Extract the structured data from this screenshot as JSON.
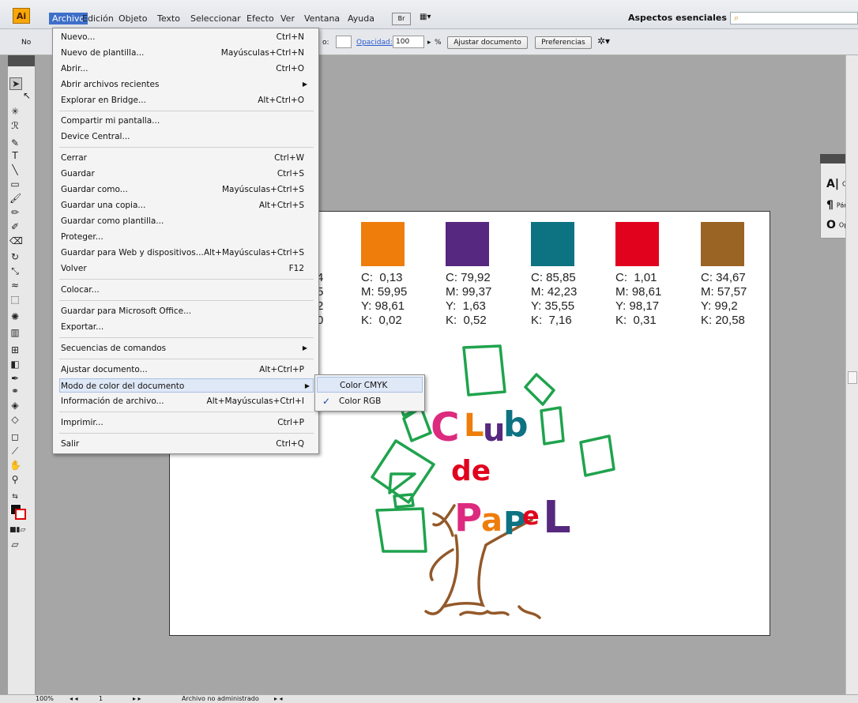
{
  "app": {
    "logo": "Ai"
  },
  "menubar": {
    "items": [
      "Archivo",
      "Edición",
      "Objeto",
      "Texto",
      "Seleccionar",
      "Efecto",
      "Ver",
      "Ventana",
      "Ayuda"
    ],
    "bridge_label": "Br",
    "workspace": "Aspectos esenciales ▾"
  },
  "controlbar": {
    "left_label": "No",
    "style_label": "o:",
    "opacity_label": "Opacidad:",
    "opacity_value": "100",
    "percent": "%",
    "ajustar_label": "Ajustar documento",
    "preferencias_label": "Preferencias"
  },
  "file_menu": {
    "items": [
      {
        "label": "Nuevo...",
        "shortcut": "Ctrl+N"
      },
      {
        "label": "Nuevo de plantilla...",
        "shortcut": "Mayúsculas+Ctrl+N"
      },
      {
        "label": "Abrir...",
        "shortcut": "Ctrl+O"
      },
      {
        "label": "Abrir archivos recientes",
        "shortcut": ""
      },
      {
        "label": "Explorar en Bridge...",
        "shortcut": "Alt+Ctrl+O"
      },
      {
        "label": "Compartir mi pantalla...",
        "shortcut": ""
      },
      {
        "label": "Device Central...",
        "shortcut": ""
      },
      {
        "label": "Cerrar",
        "shortcut": "Ctrl+W"
      },
      {
        "label": "Guardar",
        "shortcut": "Ctrl+S"
      },
      {
        "label": "Guardar como...",
        "shortcut": "Mayúsculas+Ctrl+S"
      },
      {
        "label": "Guardar una copia...",
        "shortcut": "Alt+Ctrl+S"
      },
      {
        "label": "Guardar como plantilla...",
        "shortcut": ""
      },
      {
        "label": "Proteger...",
        "shortcut": ""
      },
      {
        "label": "Guardar para Web y dispositivos...",
        "shortcut": "Alt+Mayúsculas+Ctrl+S"
      },
      {
        "label": "Volver",
        "shortcut": "F12"
      },
      {
        "label": "Colocar...",
        "shortcut": ""
      },
      {
        "label": "Guardar para Microsoft Office...",
        "shortcut": ""
      },
      {
        "label": "Exportar...",
        "shortcut": ""
      },
      {
        "label": "Secuencias de comandos",
        "shortcut": ""
      },
      {
        "label": "Ajustar documento...",
        "shortcut": "Alt+Ctrl+P"
      },
      {
        "label": "Modo de color del documento",
        "shortcut": ""
      },
      {
        "label": "Información de archivo...",
        "shortcut": "Alt+Mayúsculas+Ctrl+I"
      },
      {
        "label": "Imprimir...",
        "shortcut": "Ctrl+P"
      },
      {
        "label": "Salir",
        "shortcut": "Ctrl+Q"
      }
    ]
  },
  "color_submenu": {
    "items": [
      "Color CMYK",
      "Color RGB"
    ],
    "checked": "Color RGB"
  },
  "right_panel": {
    "items": [
      "Cará",
      "Párr",
      "Ope"
    ]
  },
  "artboard": {
    "partial_values": [
      "4",
      "5",
      "2",
      "0"
    ],
    "swatches": [
      {
        "color": "#ee7d0b",
        "c": "C:  0,13",
        "m": "M: 59,95",
        "y": "Y: 98,61",
        "k": "K:  0,02"
      },
      {
        "color": "#56287f",
        "c": "C: 79,92",
        "m": "M: 99,37",
        "y": "Y:  1,63",
        "k": "K:  0,52"
      },
      {
        "color": "#0d7383",
        "c": "C: 85,85",
        "m": "M: 42,23",
        "y": "Y: 35,55",
        "k": "K:  7,16"
      },
      {
        "color": "#e1031e",
        "c": "C:  1,01",
        "m": "M: 98,61",
        "y": "Y: 98,17",
        "k": "K:  0,31"
      },
      {
        "color": "#996424",
        "c": "C: 34,67",
        "m": "M: 57,57",
        "y": "Y: 99,2",
        "k": "K: 20,58"
      }
    ],
    "logo": {
      "line1": "CLub",
      "line2": "de",
      "line3": "PaPeL"
    }
  },
  "status": {
    "zoom": "100%",
    "page": "1",
    "doc_status": "Archivo no administrado"
  }
}
